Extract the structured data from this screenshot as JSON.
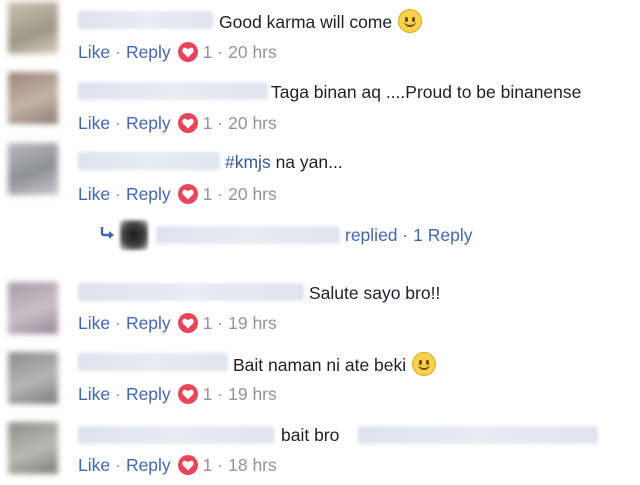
{
  "actions": {
    "like": "Like",
    "reply": "Reply",
    "dot": "·"
  },
  "comments": [
    {
      "text": "Good karma will come",
      "emoji": "smile",
      "likes": "1",
      "time": "20 hrs"
    },
    {
      "text": "Taga binan aq ....Proud to be binanense",
      "likes": "1",
      "time": "20 hrs"
    },
    {
      "hashtag": "#kmjs",
      "text": " na yan...",
      "likes": "1",
      "time": "20 hrs"
    },
    {
      "text": "Salute sayo bro!!",
      "likes": "1",
      "time": "19 hrs"
    },
    {
      "text": "Bait naman ni ate beki",
      "emoji": "smile",
      "likes": "1",
      "time": "19 hrs"
    },
    {
      "text": "bait bro",
      "likes": "1",
      "time": "18 hrs"
    }
  ],
  "reply_summary": {
    "replied": "replied",
    "count": "1 Reply"
  },
  "colors": {
    "link": "#4267b2",
    "meta": "#90949c",
    "text": "#1d2129",
    "reaction_heart": "#e8455a"
  },
  "icons": [
    "smile-emoji-icon",
    "heart-reaction-icon",
    "reply-arrow-icon"
  ]
}
